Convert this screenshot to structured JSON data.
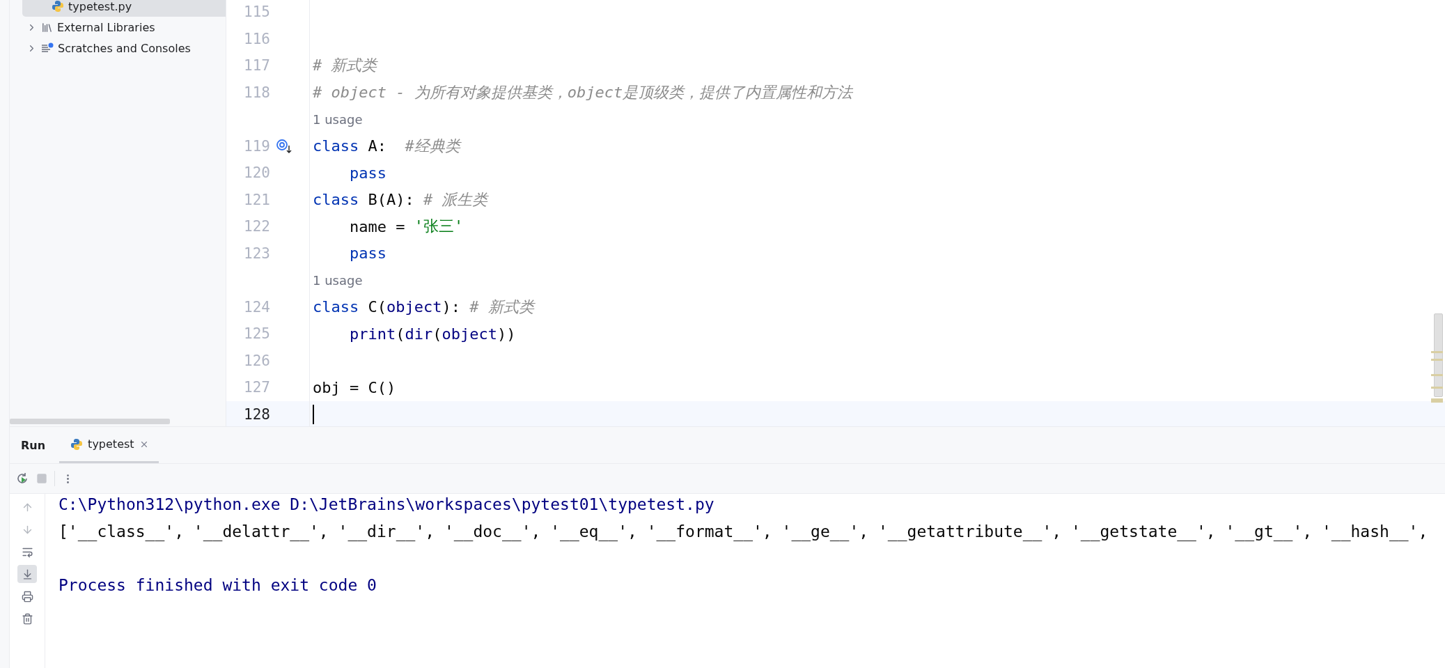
{
  "project_tree": {
    "items": [
      {
        "label": "typetest.py",
        "kind": "file",
        "selected": true
      },
      {
        "label": "External Libraries",
        "kind": "libraries",
        "expanded": false,
        "selected": false
      },
      {
        "label": "Scratches and Consoles",
        "kind": "scratches",
        "expanded": false,
        "selected": false
      }
    ]
  },
  "editor": {
    "lines": [
      {
        "kind": "code",
        "number": "115",
        "current": false,
        "gutter_mark": false
      },
      {
        "kind": "code",
        "number": "116",
        "current": false,
        "gutter_mark": false
      },
      {
        "kind": "code",
        "number": "117",
        "current": false,
        "gutter_mark": false,
        "tokens": [
          {
            "text": "# 新式类",
            "kind": "comment"
          }
        ]
      },
      {
        "kind": "code",
        "number": "118",
        "current": false,
        "gutter_mark": false,
        "tokens": [
          {
            "text": "# object - 为所有对象提供基类，object是顶级类，提供了内置属性和方法",
            "kind": "comment"
          }
        ]
      },
      {
        "kind": "usage",
        "text": "1 usage"
      },
      {
        "kind": "code",
        "number": "119",
        "current": false,
        "gutter_mark": true,
        "tokens": [
          {
            "text": "class",
            "kind": "keyword"
          },
          {
            "text": " A:  ",
            "kind": "plain"
          },
          {
            "text": "#经典类",
            "kind": "comment"
          }
        ]
      },
      {
        "kind": "code",
        "number": "120",
        "current": false,
        "gutter_mark": false,
        "tokens": [
          {
            "text": "    pass",
            "kind": "keyword"
          }
        ]
      },
      {
        "kind": "code",
        "number": "121",
        "current": false,
        "gutter_mark": false,
        "tokens": [
          {
            "text": "class",
            "kind": "keyword"
          },
          {
            "text": " B(A): ",
            "kind": "plain"
          },
          {
            "text": "# 派生类",
            "kind": "comment"
          }
        ]
      },
      {
        "kind": "code",
        "number": "122",
        "current": false,
        "gutter_mark": false,
        "tokens": [
          {
            "text": "    name = ",
            "kind": "plain"
          },
          {
            "text": "'张三'",
            "kind": "string"
          }
        ]
      },
      {
        "kind": "code",
        "number": "123",
        "current": false,
        "gutter_mark": false,
        "tokens": [
          {
            "text": "    pass",
            "kind": "keyword"
          }
        ]
      },
      {
        "kind": "usage",
        "text": "1 usage"
      },
      {
        "kind": "code",
        "number": "124",
        "current": false,
        "gutter_mark": false,
        "tokens": [
          {
            "text": "class",
            "kind": "keyword"
          },
          {
            "text": " C(",
            "kind": "plain"
          },
          {
            "text": "object",
            "kind": "builtin"
          },
          {
            "text": "): ",
            "kind": "plain"
          },
          {
            "text": "# 新式类",
            "kind": "comment"
          }
        ]
      },
      {
        "kind": "code",
        "number": "125",
        "current": false,
        "gutter_mark": false,
        "tokens": [
          {
            "text": "    print",
            "kind": "builtin"
          },
          {
            "text": "(",
            "kind": "plain"
          },
          {
            "text": "dir",
            "kind": "builtin"
          },
          {
            "text": "(",
            "kind": "plain"
          },
          {
            "text": "object",
            "kind": "builtin"
          },
          {
            "text": "))",
            "kind": "plain"
          }
        ]
      },
      {
        "kind": "code",
        "number": "126",
        "current": false,
        "gutter_mark": false
      },
      {
        "kind": "code",
        "number": "127",
        "current": false,
        "gutter_mark": false,
        "tokens": [
          {
            "text": "obj = C()",
            "kind": "plain"
          }
        ]
      },
      {
        "kind": "code",
        "number": "128",
        "current": true,
        "gutter_mark": false
      }
    ]
  },
  "run_panel": {
    "title": "Run",
    "tabs": [
      {
        "label": "typetest",
        "selected": true
      }
    ],
    "soft_wrap": false,
    "scroll_to_end": true,
    "output": [
      {
        "kind": "system",
        "text": "C:\\Python312\\python.exe D:\\JetBrains\\workspaces\\pytest01\\typetest.py"
      },
      {
        "kind": "stdout",
        "text": "['__class__', '__delattr__', '__dir__', '__doc__', '__eq__', '__format__', '__ge__', '__getattribute__', '__getstate__', '__gt__', '__hash__',"
      },
      {
        "kind": "blank"
      },
      {
        "kind": "system",
        "text": "Process finished with exit code 0"
      }
    ]
  }
}
